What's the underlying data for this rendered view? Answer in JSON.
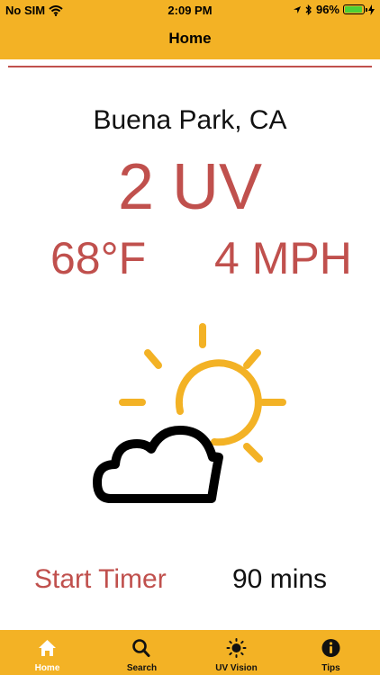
{
  "status_bar": {
    "carrier": "No SIM",
    "time": "2:09 PM",
    "battery": "96%",
    "battery_level": 0.96
  },
  "header": {
    "title": "Home"
  },
  "weather": {
    "location": "Buena Park, CA",
    "uv_index": "2 UV",
    "temperature": "68°F",
    "wind": "4 MPH",
    "icon": "partly-cloudy-icon"
  },
  "timer": {
    "button_label": "Start Timer",
    "duration": "90 mins"
  },
  "tabs": [
    {
      "label": "Home",
      "icon": "home-icon",
      "active": true
    },
    {
      "label": "Search",
      "icon": "search-icon",
      "active": false
    },
    {
      "label": "UV Vision",
      "icon": "sun-icon",
      "active": false
    },
    {
      "label": "Tips",
      "icon": "info-icon",
      "active": false
    }
  ],
  "colors": {
    "accent": "#f3b225",
    "primary_text": "#c0504d",
    "active_tab": "#ffffff"
  }
}
